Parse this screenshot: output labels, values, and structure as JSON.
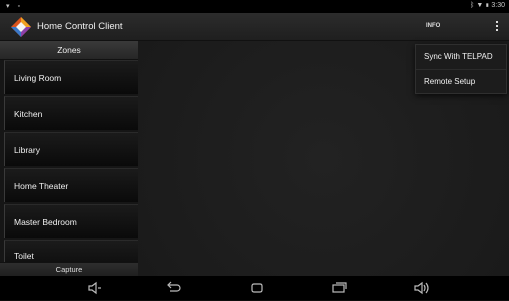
{
  "status_bar": {
    "left_icons": [
      "signal-icon",
      "image-icon"
    ],
    "right_icons": [
      "bluetooth-icon",
      "wifi-icon",
      "battery-icon"
    ],
    "time": "3:30"
  },
  "action_bar": {
    "title": "Home Control Client",
    "info_label": "INFO",
    "overflow_icon": "more-vert-icon"
  },
  "sidebar": {
    "header": "Zones",
    "zones": [
      {
        "label": "Living Room"
      },
      {
        "label": "Kitchen"
      },
      {
        "label": "Library"
      },
      {
        "label": "Home Theater"
      },
      {
        "label": "Master Bedroom"
      },
      {
        "label": "Toilet"
      }
    ],
    "capture_label": "Capture"
  },
  "overflow_menu": {
    "items": [
      {
        "label": "Sync With TELPAD"
      },
      {
        "label": "Remote Setup"
      }
    ]
  },
  "nav_bar": {
    "icons": [
      "volume-down-icon",
      "back-icon",
      "home-icon",
      "recents-icon",
      "volume-up-icon"
    ]
  },
  "colors": {
    "background": "#0d0d0d",
    "action_bar": "#262626",
    "text": "#f0f0f0"
  }
}
